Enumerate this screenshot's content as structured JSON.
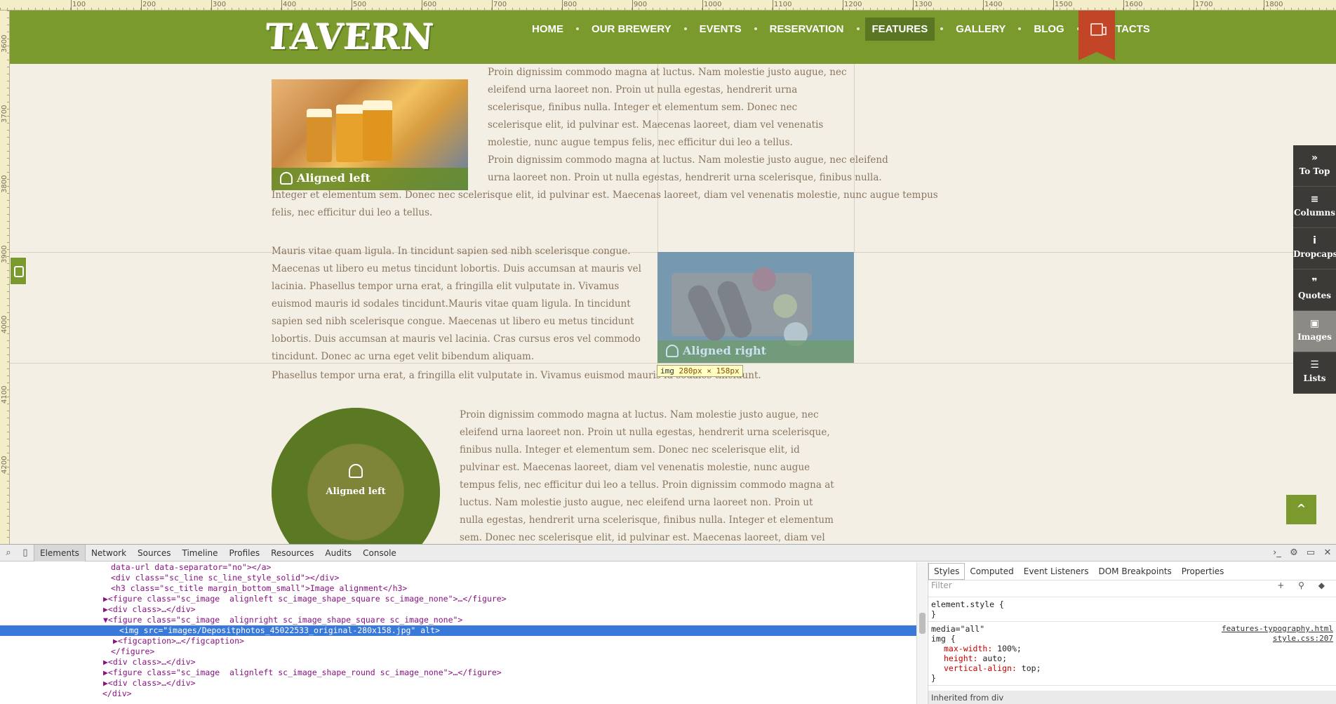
{
  "ruler": {
    "top_numbers": [
      "100",
      "200",
      "300",
      "400",
      "500",
      "600",
      "700",
      "800",
      "900",
      "1000",
      "1100",
      "1200",
      "1300",
      "1400",
      "1500",
      "1600",
      "1700",
      "1800"
    ],
    "left_numbers": [
      "3600",
      "3700",
      "3800",
      "3900",
      "4000",
      "4100",
      "4200"
    ]
  },
  "header": {
    "logo": "TAVERN",
    "nav": [
      "HOME",
      "OUR BREWERY",
      "EVENTS",
      "RESERVATION",
      "FEATURES",
      "GALLERY",
      "BLOG",
      "CONTACTS"
    ],
    "active_nav": "FEATURES",
    "brand_color": "#7a9a2e"
  },
  "content": {
    "block1": {
      "caption": "Aligned left",
      "para": "Proin dignissim commodo magna at luctus. Nam molestie justo augue, nec eleifend urna laoreet non. Proin ut nulla egestas, hendrerit urna scelerisque, finibus nulla. Integer et elementum sem. Donec nec scelerisque elit, id pulvinar est. Maecenas laoreet, diam vel venenatis molestie, nunc augue tempus felis, nec efficitur dui leo a tellus.",
      "para2_lines": [
        "Proin dignissim commodo magna at luctus. Nam molestie justo augue, nec eleifend",
        "urna laoreet non. Proin ut nulla egestas, hendrerit urna scelerisque, finibus nulla.",
        "Integer et elementum sem. Donec nec scelerisque elit, id pulvinar est. Maecenas laoreet, diam vel venenatis molestie, nunc augue tempus",
        "felis, nec efficitur dui leo a tellus."
      ]
    },
    "block2": {
      "caption": "Aligned right",
      "para": "Mauris vitae quam ligula. In tincidunt sapien sed nibh scelerisque congue. Maecenas ut libero eu metus tincidunt lobortis. Duis accumsan at mauris vel lacinia. Phasellus tempor urna erat, a fringilla elit vulputate in. Vivamus euismod mauris id sodales tincidunt.Mauris vitae quam ligula. In tincidunt sapien sed nibh scelerisque congue. Maecenas ut libero eu metus tincidunt lobortis. Duis accumsan at mauris vel lacinia. Cras cursus eros vel commodo tincidunt. Donec ac urna eget velit bibendum aliquam.",
      "last_line": "Phasellus tempor urna erat, a fringilla elit vulputate in. Vivamus euismod mauris id sodales tincidunt.",
      "tooltip_tag": "img",
      "tooltip_size": "280px × 158px"
    },
    "block3": {
      "caption": "Aligned left",
      "para": "Proin dignissim commodo magna at luctus. Nam molestie justo augue, nec eleifend urna laoreet non. Proin ut nulla egestas, hendrerit urna scelerisque, finibus nulla. Integer et elementum sem. Donec nec scelerisque elit, id pulvinar est. Maecenas laoreet, diam vel venenatis molestie, nunc augue tempus felis, nec efficitur dui leo a tellus. Proin dignissim commodo magna at luctus. Nam molestie justo augue, nec eleifend urna laoreet non. Proin ut nulla egestas, hendrerit urna scelerisque, finibus nulla. Integer et elementum sem. Donec nec scelerisque elit, id pulvinar est. Maecenas laoreet, diam vel venenatis molestie, nunc augue tempus felis, nec efficitur dui leo a tellus. Nam molestie"
    }
  },
  "toolbar": [
    {
      "icon": "»",
      "label": "To Top"
    },
    {
      "icon": "≡",
      "label": "Columns"
    },
    {
      "icon": "i",
      "label": "Dropcaps"
    },
    {
      "icon": "❞",
      "label": "Quotes"
    },
    {
      "icon": "▣",
      "label": "Images"
    },
    {
      "icon": "☰",
      "label": "Lists"
    }
  ],
  "scroll_top_icon": "^",
  "devtools": {
    "tabs": [
      "Elements",
      "Network",
      "Sources",
      "Timeline",
      "Profiles",
      "Resources",
      "Audits",
      "Console"
    ],
    "active_tab": "Elements",
    "code": [
      "data-url data-separator=\"no\"></a>",
      "<div class=\"sc_line sc_line_style_solid\"></div>",
      "<h3 class=\"sc_title margin_bottom_small\">Image alignment</h3>",
      "▶<figure class=\"sc_image  alignleft sc_image_shape_square sc_image_none\">…</figure>",
      "▶<div class>…</div>",
      "▼<figure class=\"sc_image  alignright sc_image_shape_square sc_image_none\">",
      "<img src=\"images/Depositphotos_45022533_original-280x158.jpg\" alt>",
      "▶<figcaption>…</figcaption>",
      "</figure>",
      "▶<div class>…</div>",
      "▶<figure class=\"sc_image  alignleft sc_image_shape_round sc_image_none\">…</figure>",
      "▶<div class>…</div>",
      "</div>"
    ],
    "styles_tabs": [
      "Styles",
      "Computed",
      "Event Listeners",
      "DOM Breakpoints",
      "Properties"
    ],
    "filter_placeholder": "Filter",
    "element_style": "element.style {",
    "media": "media=\"all\"",
    "source_file": "features-typography.html",
    "source_css": "style.css:207",
    "selector": "img {",
    "props": [
      {
        "name": "max-width",
        "value": "100%;"
      },
      {
        "name": "height",
        "value": "auto;"
      },
      {
        "name": "vertical-align",
        "value": "top;"
      }
    ],
    "close_brace": "}",
    "inherited": "Inherited from div"
  }
}
